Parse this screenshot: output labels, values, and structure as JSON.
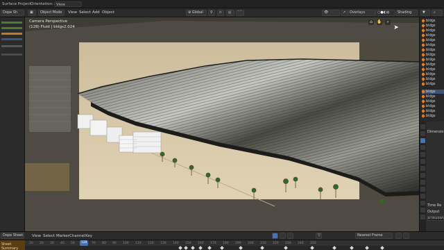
{
  "topbar": {
    "workspace": "Surface Project",
    "orientation_label": "Orientation:",
    "orientation_value": "View"
  },
  "header": {
    "dopesheet_tab": "Dope Sh",
    "mode": "Object Mode",
    "menus": [
      "View",
      "Select",
      "Add",
      "Object"
    ],
    "transform": "Global",
    "overlays": "Overlays",
    "shading": "Shading"
  },
  "viewport": {
    "camera_label": "Camera Perspective",
    "object_label": "(128) Fluid | bldgs2.024"
  },
  "outliner": {
    "items": [
      "bldgs",
      "bldgs",
      "bldgs",
      "bldgs",
      "bldgs",
      "bldgs",
      "bldgs",
      "bldgs",
      "bldgs",
      "bldgs",
      "bldgs",
      "bldgs",
      "bldgs",
      "bldgs",
      "bldgs",
      "bldgs",
      "bldgs",
      "bldgs",
      "bldgs",
      "bldgs"
    ],
    "selected_index": 14
  },
  "properties": {
    "dimensions_label": "Dimensio",
    "time_label": "Time Re",
    "output_label": "Output",
    "path_value": "D:\\tsunami2"
  },
  "dopesheet": {
    "editor": "Dope Sheet",
    "menus": [
      "View",
      "Select",
      "Marker",
      "Channel",
      "Key"
    ],
    "snap": "Nearest Frame",
    "summary": "Sheet Summary",
    "current_frame": "128",
    "ticks": [
      "10",
      "20",
      "30",
      "40",
      "50",
      "60",
      "70",
      "80",
      "90",
      "100",
      "110",
      "120",
      "130",
      "140",
      "150",
      "160",
      "170",
      "180",
      "190",
      "200",
      "210",
      "220",
      "230",
      "240",
      "250"
    ]
  },
  "colors": {
    "accent": "#3e5479",
    "active_blue": "#4772b3",
    "object_orange": "#e57d24",
    "sand": "#d9c8a6"
  }
}
